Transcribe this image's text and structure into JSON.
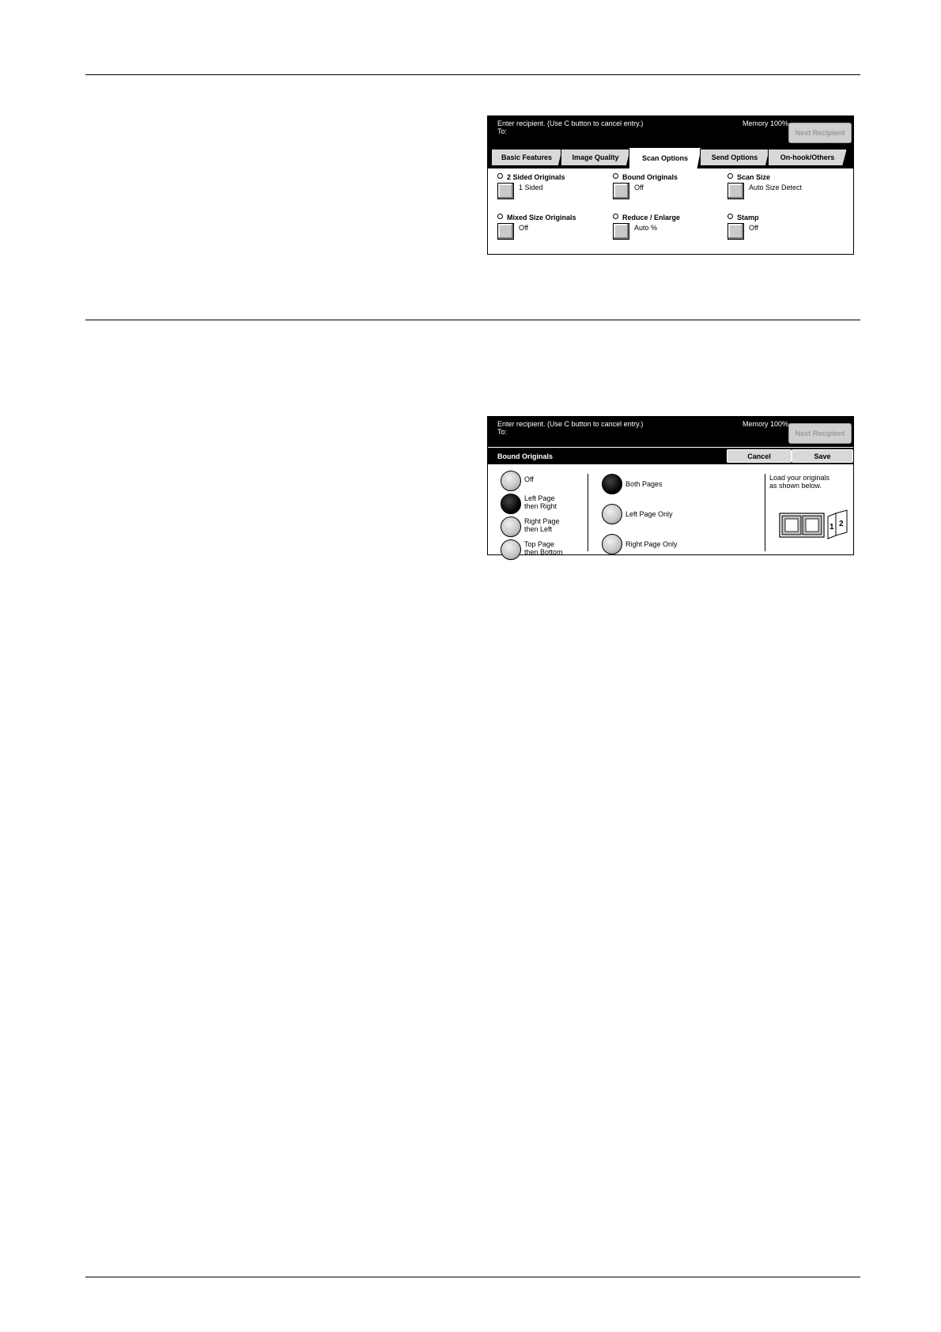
{
  "scan_options_screen": {
    "message_line1": "Enter recipient. (Use C button to cancel entry.)",
    "message_line2": "To:",
    "memory": "Memory 100%",
    "next_recipient": "Next Recipient",
    "tabs": [
      {
        "label": "Basic Features"
      },
      {
        "label": "Image Quality"
      },
      {
        "label": "Scan Options",
        "active": true
      },
      {
        "label": "Send Options"
      },
      {
        "label": "On-hook/Others"
      }
    ],
    "options": [
      {
        "title": "2 Sided Originals",
        "value": "1 Sided"
      },
      {
        "title": "Bound Originals",
        "value": "Off"
      },
      {
        "title": "Scan Size",
        "value": "Auto Size Detect"
      },
      {
        "title": "Mixed Size Originals",
        "value": "Off"
      },
      {
        "title": "Reduce / Enlarge",
        "value": "Auto %"
      },
      {
        "title": "Stamp",
        "value": "Off"
      }
    ]
  },
  "bound_originals_screen": {
    "message_line1": "Enter recipient. (Use C button to cancel entry.)",
    "message_line2": "To:",
    "memory": "Memory 100%",
    "next_recipient": "Next Recipient",
    "title": "Bound Originals",
    "cancel": "Cancel",
    "save": "Save",
    "direction_options": [
      {
        "line1": "Off",
        "line2": "",
        "selected": false
      },
      {
        "line1": "Left Page",
        "line2": "then Right",
        "selected": true
      },
      {
        "line1": "Right Page",
        "line2": "then Left",
        "selected": false
      },
      {
        "line1": "Top Page",
        "line2": "then Bottom",
        "selected": false
      }
    ],
    "page_options": [
      {
        "label": "Both Pages",
        "selected": true
      },
      {
        "label": "Left Page Only",
        "selected": false
      },
      {
        "label": "Right Page Only",
        "selected": false
      }
    ],
    "load_text_line1": "Load your originals",
    "load_text_line2": "as shown below.",
    "book_page_labels": [
      "1",
      "2"
    ]
  }
}
